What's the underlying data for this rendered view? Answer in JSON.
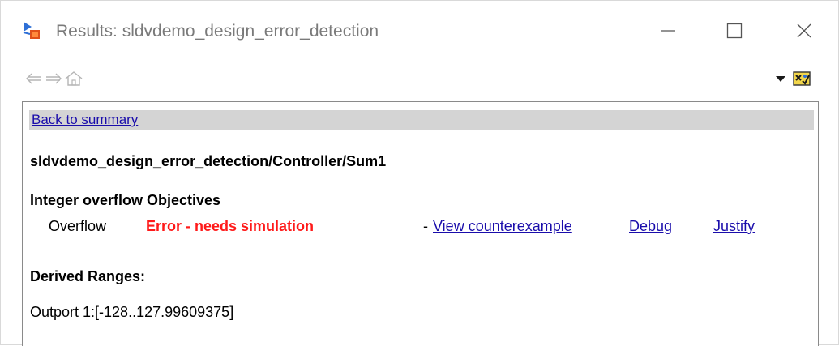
{
  "window": {
    "title": "Results: sldvdemo_design_error_detection",
    "icon": "simulink-results-icon",
    "controls": [
      "minimize-icon",
      "maximize-icon",
      "close-icon"
    ]
  },
  "toolbar": {
    "icons": [
      "back-arrow-icon",
      "forward-arrow-icon",
      "home-icon",
      "dropdown-arrow-icon",
      "design-verifier-icon"
    ]
  },
  "report": {
    "back_link": "Back to summary",
    "block_path": "sldvdemo_design_error_detection/Controller/Sum1",
    "objectives_heading": "Integer overflow Objectives",
    "objective": {
      "label": "Overflow",
      "status": "Error - needs simulation",
      "separator": "-",
      "view_link": "View counterexample",
      "debug_link": "Debug",
      "justify_link": "Justify"
    },
    "ranges_heading": "Derived Ranges:",
    "ranges_value": "Outport 1:[-128..127.99609375]"
  },
  "colors": {
    "error": "#ff1a1a",
    "link": "#1a0dab",
    "backbar": "#d4d4d4"
  }
}
